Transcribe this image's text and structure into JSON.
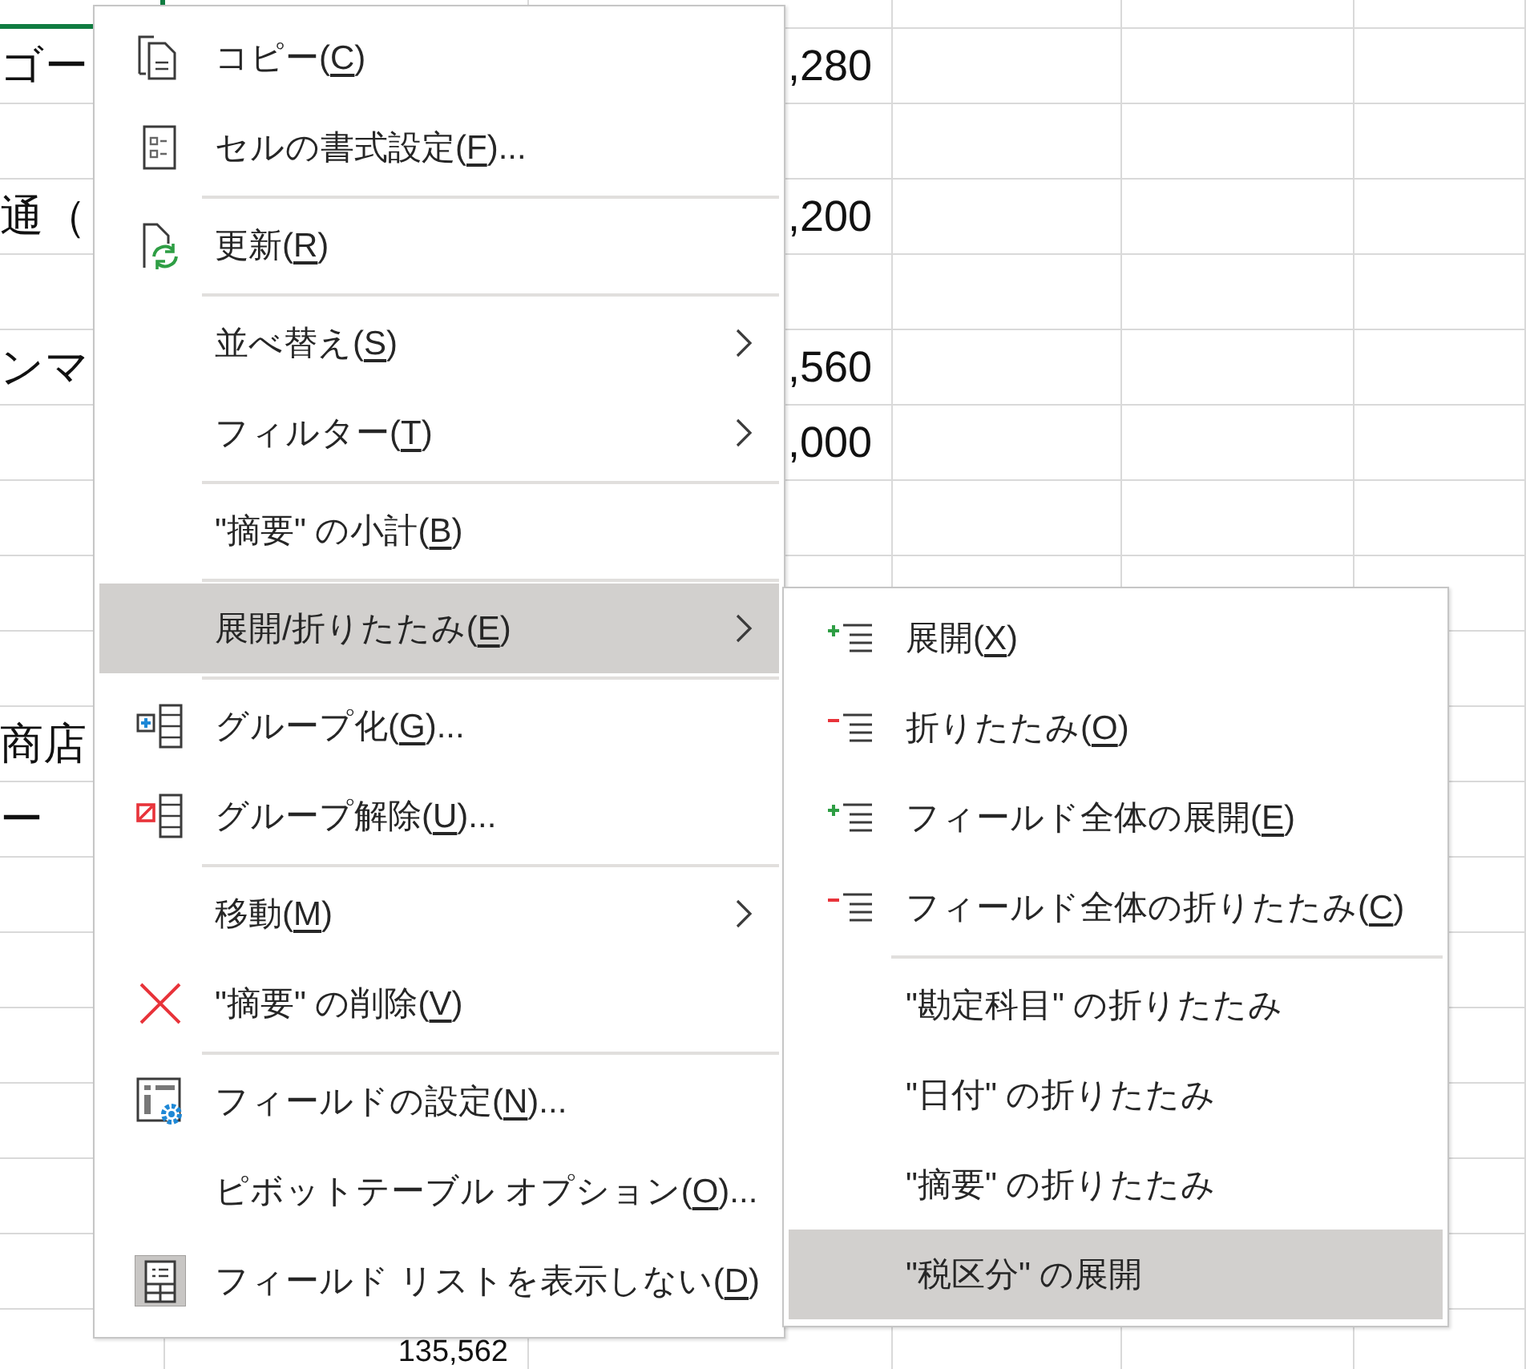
{
  "sheet": {
    "selection_border": true,
    "rows": [
      {},
      {
        "column_1": "ゴー",
        "column_3": ",280"
      },
      {},
      {
        "column_1": "通（",
        "column_3": ",200"
      },
      {},
      {
        "column_1": "ンマ",
        "column_3": ",560"
      },
      {
        "column_3": ",000"
      },
      {},
      {},
      {},
      {
        "column_1": "商店"
      },
      {
        "column_1": "ー"
      },
      {},
      {},
      {},
      {},
      {},
      {},
      {
        "column_2": "135,562"
      }
    ]
  },
  "context_menu": {
    "groups": [
      {
        "items": [
          {
            "kind": "copy",
            "text": "コピー(",
            "key": "C",
            "after": ")",
            "submenu": false,
            "selected": false,
            "checked": false
          },
          {
            "kind": "format",
            "text": "セルの書式設定(",
            "key": "F",
            "after": ")...",
            "submenu": false,
            "selected": false,
            "checked": false
          }
        ]
      },
      {
        "items": [
          {
            "kind": "refresh",
            "text": "更新(",
            "key": "R",
            "after": ")",
            "submenu": false,
            "selected": false,
            "checked": false
          }
        ]
      },
      {
        "items": [
          {
            "kind": "plain",
            "text": "並べ替え(",
            "key": "S",
            "after": ")",
            "submenu": true,
            "selected": false,
            "checked": false
          },
          {
            "kind": "plain",
            "text": "フィルター(",
            "key": "T",
            "after": ")",
            "submenu": true,
            "selected": false,
            "checked": false
          }
        ]
      },
      {
        "items": [
          {
            "kind": "plain",
            "text": "\"摘要\" の小計(",
            "key": "B",
            "after": ")",
            "submenu": false,
            "selected": false,
            "checked": false
          }
        ]
      },
      {
        "items": [
          {
            "kind": "plain",
            "text": "展開/折りたたみ(",
            "key": "E",
            "after": ")",
            "submenu": true,
            "selected": true,
            "checked": false
          }
        ]
      },
      {
        "items": [
          {
            "kind": "group",
            "text": "グループ化(",
            "key": "G",
            "after": ")...",
            "submenu": false,
            "selected": false,
            "checked": false
          },
          {
            "kind": "ungroup",
            "text": "グループ解除(",
            "key": "U",
            "after": ")...",
            "submenu": false,
            "selected": false,
            "checked": false
          }
        ]
      },
      {
        "items": [
          {
            "kind": "plain",
            "text": "移動(",
            "key": "M",
            "after": ")",
            "submenu": true,
            "selected": false,
            "checked": false
          },
          {
            "kind": "delete",
            "text": "\"摘要\" の削除(",
            "key": "V",
            "after": ")",
            "submenu": false,
            "selected": false,
            "checked": false
          }
        ]
      },
      {
        "items": [
          {
            "kind": "settings",
            "text": "フィールドの設定(",
            "key": "N",
            "after": ")...",
            "submenu": false,
            "selected": false,
            "checked": false
          },
          {
            "kind": "plain",
            "text": "ピボットテーブル オプション(",
            "key": "O",
            "after": ")...",
            "submenu": false,
            "selected": false,
            "checked": false
          },
          {
            "kind": "list",
            "text": "フィールド リストを表示しない(",
            "key": "D",
            "after": ")",
            "submenu": false,
            "selected": false,
            "checked": true
          }
        ]
      }
    ]
  },
  "submenu": {
    "groups": [
      {
        "items": [
          {
            "kind": "expand",
            "text": "展開(",
            "key": "X",
            "after": ")",
            "selected": false
          },
          {
            "kind": "collapse",
            "text": "折りたたみ(",
            "key": "O",
            "after": ")",
            "selected": false
          },
          {
            "kind": "expand",
            "text": "フィールド全体の展開(",
            "key": "E",
            "after": ")",
            "selected": false
          },
          {
            "kind": "collapse",
            "text": "フィールド全体の折りたたみ(",
            "key": "C",
            "after": ")",
            "selected": false
          }
        ]
      },
      {
        "items": [
          {
            "kind": "plain",
            "text": "\"勘定科目\" の折りたたみ",
            "selected": false
          },
          {
            "kind": "plain",
            "text": "\"日付\" の折りたたみ",
            "selected": false
          },
          {
            "kind": "plain",
            "text": "\"摘要\" の折りたたみ",
            "selected": false
          },
          {
            "kind": "plain",
            "text": "\"税区分\" の展開",
            "selected": true
          }
        ]
      }
    ]
  }
}
